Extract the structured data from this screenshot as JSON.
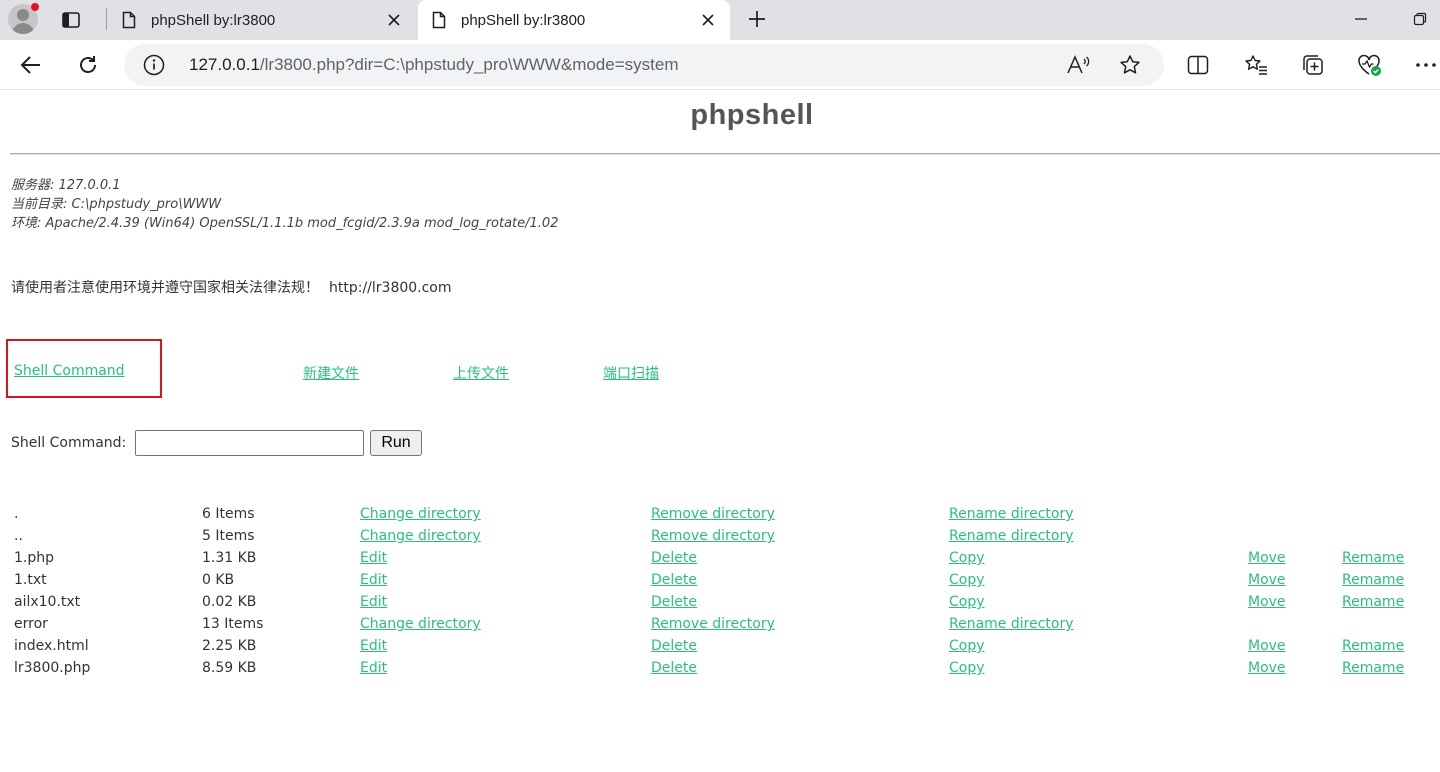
{
  "browser": {
    "tabs": [
      {
        "title": "phpShell by:lr3800",
        "active": false
      },
      {
        "title": "phpShell by:lr3800",
        "active": true
      }
    ],
    "url_host": "127.0.0.1",
    "url_rest": "/lr3800.php?dir=C:\\phpstudy_pro\\WWW&mode=system",
    "icons": [
      "profile-icon",
      "tab-actions-icon",
      "document-icon",
      "close-icon",
      "plus-icon",
      "minimize-icon",
      "restore-icon",
      "back-icon",
      "refresh-icon",
      "info-icon",
      "read-aloud-icon",
      "star-icon",
      "split-screen-icon",
      "favorites-icon",
      "collections-icon",
      "browser-essentials-icon",
      "more-icon"
    ]
  },
  "page": {
    "title": "phpshell",
    "server_line": "服务器: 127.0.0.1",
    "dir_line": "当前目录: C:\\phpstudy_pro\\WWW",
    "env_line": "环境: Apache/2.4.39 (Win64) OpenSSL/1.1.1b mod_fcgid/2.3.9a mod_log_rotate/1.02",
    "notice": "请使用者注意使用环境并遵守国家相关法律法规！",
    "notice_site": "http://lr3800.com",
    "nav": {
      "shell_command": "Shell Command",
      "new_file": "新建文件",
      "upload_file": "上传文件",
      "port_scan": "端口扫描"
    },
    "command": {
      "label": "Shell Command:",
      "value": "",
      "run_label": "Run"
    },
    "files": [
      {
        "name": ".",
        "size": "6 Items",
        "a1": "Change directory",
        "a2": "Remove directory",
        "a3": "Rename directory",
        "a4": "",
        "a5": ""
      },
      {
        "name": "..",
        "size": "5 Items",
        "a1": "Change directory",
        "a2": "Remove directory",
        "a3": "Rename directory",
        "a4": "",
        "a5": ""
      },
      {
        "name": "1.php",
        "size": "1.31 KB",
        "a1": "Edit",
        "a2": "Delete",
        "a3": "Copy",
        "a4": "Move",
        "a5": "Remame"
      },
      {
        "name": "1.txt",
        "size": "0 KB",
        "a1": "Edit",
        "a2": "Delete",
        "a3": "Copy",
        "a4": "Move",
        "a5": "Remame"
      },
      {
        "name": "ailx10.txt",
        "size": "0.02 KB",
        "a1": "Edit",
        "a2": "Delete",
        "a3": "Copy",
        "a4": "Move",
        "a5": "Remame"
      },
      {
        "name": "error",
        "size": "13 Items",
        "a1": "Change directory",
        "a2": "Remove directory",
        "a3": "Rename directory",
        "a4": "",
        "a5": ""
      },
      {
        "name": "index.html",
        "size": "2.25 KB",
        "a1": "Edit",
        "a2": "Delete",
        "a3": "Copy",
        "a4": "Move",
        "a5": "Remame"
      },
      {
        "name": "lr3800.php",
        "size": "8.59 KB",
        "a1": "Edit",
        "a2": "Delete",
        "a3": "Copy",
        "a4": "Move",
        "a5": "Remame"
      }
    ],
    "colors": {
      "link": "#2bbf7f",
      "highlight_box": "#d9141e",
      "title": "#555555"
    }
  }
}
